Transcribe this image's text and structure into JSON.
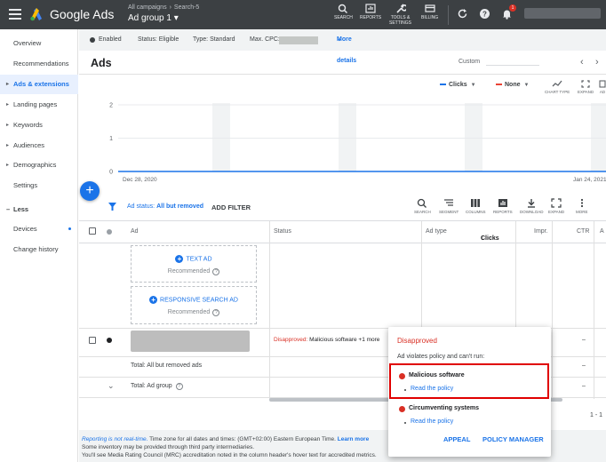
{
  "topbar": {
    "app_name": "Google Ads",
    "breadcrumb": [
      "All campaigns",
      "Search-5"
    ],
    "breadcrumb_sep": "›",
    "ad_group_title": "Ad group 1",
    "tools": [
      "SEARCH",
      "REPORTS",
      "TOOLS &",
      "SETTINGS",
      "BILLING"
    ],
    "notification_count": "1"
  },
  "nav": {
    "items": [
      "Overview",
      "Recommendations",
      "Ads & extensions",
      "Landing pages",
      "Keywords",
      "Audiences",
      "Demographics",
      "Settings"
    ],
    "less_label": "Less",
    "extra_items": [
      "Devices",
      "Change history"
    ]
  },
  "status_bar": {
    "enabled": "Enabled",
    "status": "Status: Eligible",
    "type": "Type: Standard",
    "max_cpc": "Max. CPC:",
    "more_details": "More details"
  },
  "ads_header": {
    "title": "Ads",
    "custom_label": "Custom"
  },
  "chart_controls": {
    "metric1": "Clicks",
    "metric1_color": "#1a73e8",
    "metric2": "None",
    "metric2_color": "#ea4335",
    "tools": [
      "CHART TYPE",
      "EXPAND",
      "AD"
    ]
  },
  "chart_data": {
    "type": "line",
    "x": [
      "Dec 28, 2020",
      "Jan 24, 2021"
    ],
    "x_tick_labels": [
      "Dec 28, 2020",
      "Jan 24, 2021"
    ],
    "series": [
      {
        "name": "Clicks",
        "values": [
          0,
          0
        ]
      }
    ],
    "y_ticks": [
      "2",
      "1",
      "0"
    ],
    "ylim": [
      0,
      2
    ],
    "color": "#1a73e8"
  },
  "filter_row": {
    "ad_status_label": "Ad status:",
    "ad_status_value": "All but removed",
    "add_filter": "ADD FILTER",
    "tools": [
      "SEARCH",
      "SEGMENT",
      "COLUMNS",
      "REPORTS",
      "DOWNLOAD",
      "EXPAND",
      "MORE"
    ]
  },
  "table": {
    "columns": [
      "Ad",
      "Status",
      "Ad type",
      "Clicks",
      "Impr.",
      "CTR",
      "A"
    ],
    "text_ad": "TEXT AD",
    "responsive_ad": "RESPONSIVE SEARCH AD",
    "recommended": "Recommended",
    "row_status_prefix": "Disapproved:",
    "row_status_rest": "Malicious software +1 more",
    "total_removed": "Total: All but removed ads",
    "total_group": "Total: Ad group",
    "dash": "–",
    "pagination": "1 - 1"
  },
  "footer": {
    "line1_link": "Reporting is not real-time.",
    "line1_text": "Time zone for all dates and times: (GMT+02:00) Eastern European Time.",
    "line1_learn": "Learn more",
    "line2": "Some inventory may be provided through third party intermediaries.",
    "line3": "You'll see Media Rating Council (MRC) accreditation noted in the column header's hover text for accredited metrics."
  },
  "popup": {
    "title": "Disapproved",
    "subtitle": "Ad violates policy and can't run:",
    "policies": [
      {
        "name": "Malicious software",
        "link": "Read the policy"
      },
      {
        "name": "Circumventing systems",
        "link": "Read the policy"
      }
    ],
    "appeal": "APPEAL",
    "policy_manager": "POLICY MANAGER"
  }
}
